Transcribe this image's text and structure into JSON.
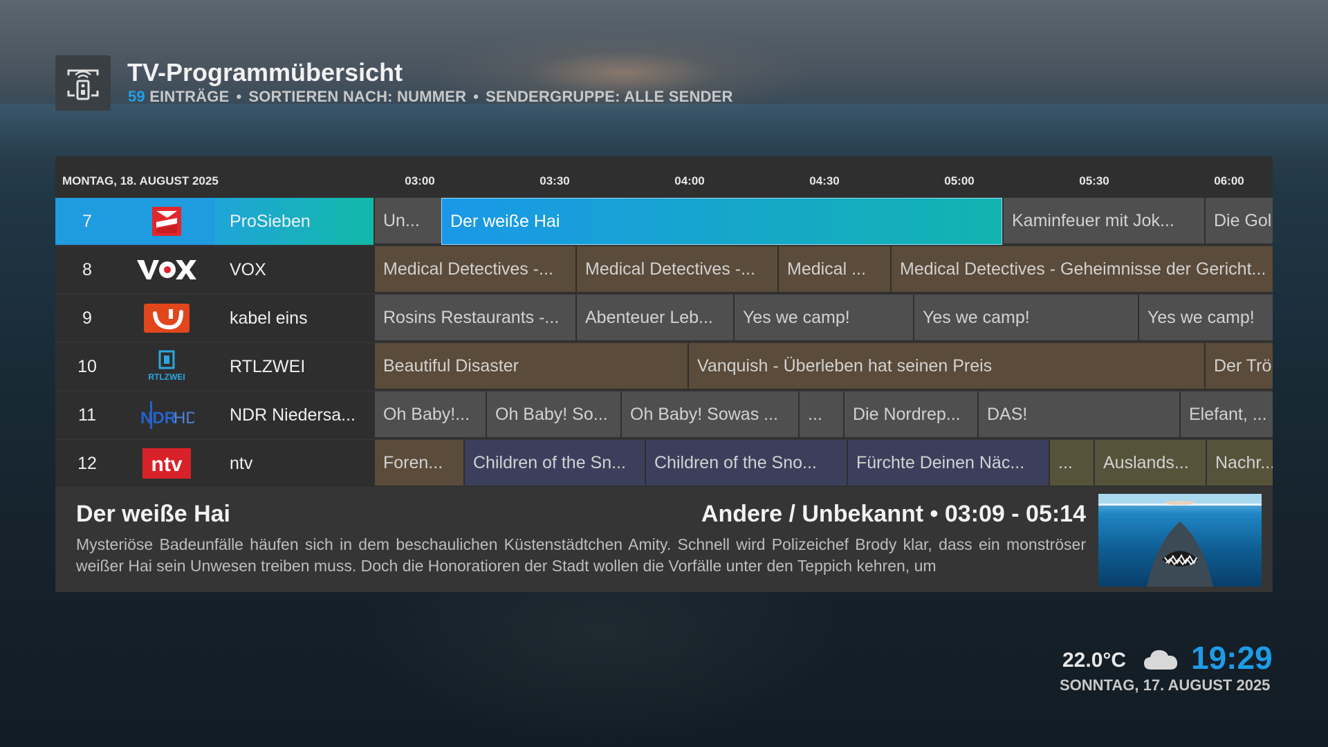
{
  "header": {
    "title": "TV-Programmübersicht",
    "entries_count": "59",
    "entries_label": "EINTRÄGE",
    "sort_label": "SORTIEREN NACH: NUMMER",
    "group_label": "SENDERGRUPPE: ALLE SENDER",
    "icon": "tv-remote-icon"
  },
  "timeline": {
    "date": "MONTAG, 18. AUGUST 2025",
    "ticks": [
      "03:00",
      "03:30",
      "04:00",
      "04:30",
      "05:00",
      "05:30",
      "06:00"
    ]
  },
  "channels": [
    {
      "number": "7",
      "name": "ProSieben",
      "logo": "prosieben-logo"
    },
    {
      "number": "8",
      "name": "VOX",
      "logo": "vox-logo"
    },
    {
      "number": "9",
      "name": "kabel eins",
      "logo": "kabel-eins-logo"
    },
    {
      "number": "10",
      "name": "RTLZWEI",
      "logo": "rtlzwei-logo"
    },
    {
      "number": "11",
      "name": "NDR Niedersa...",
      "logo": "ndr-hd-logo"
    },
    {
      "number": "12",
      "name": "ntv",
      "logo": "ntv-logo"
    }
  ],
  "programs": {
    "r0": [
      "Un...",
      "Der weiße Hai",
      "Kaminfeuer mit Jok...",
      "Die Gol"
    ],
    "r1": [
      "Medical Detectives -...",
      "Medical Detectives -...",
      "Medical ...",
      "Medical Detectives - Geheimnisse der Gericht..."
    ],
    "r2": [
      "Rosins Restaurants -...",
      "Abenteuer Leb...",
      "Yes we camp!",
      "Yes we camp!",
      "Yes we camp!"
    ],
    "r3": [
      "Beautiful Disaster",
      "Vanquish - Überleben hat seinen Preis",
      "Der Trö"
    ],
    "r4": [
      "Oh Baby!...",
      "Oh Baby! So...",
      "Oh Baby! Sowas ...",
      "...",
      "Die Nordrep...",
      "DAS!",
      "Elefant, ..."
    ],
    "r5": [
      "Foren...",
      "Children of the Sn...",
      "Children of the Sno...",
      "Fürchte Deinen Näc...",
      "...",
      "Auslands...",
      "Nachr..."
    ]
  },
  "selected": {
    "title": "Der weiße Hai",
    "genre": "Andere / Unbekannt",
    "time": "03:09 - 05:14",
    "description": "Mysteriöse Badeunfälle häufen sich in dem beschaulichen Küstenstädtchen Amity. Schnell wird Polizeichef Brody klar, dass ein monströser weißer Hai sein Unwesen treiben muss. Doch die Honoratioren der Stadt wollen die Vorfälle unter den Teppich kehren, um"
  },
  "status": {
    "temperature": "22.0°C",
    "weather_icon": "cloud-icon",
    "clock": "19:29",
    "today": "SONNTAG, 17. AUGUST 2025"
  },
  "colors": {
    "accent": "#1f9be6",
    "selected_start": "#1a98e8",
    "selected_end": "#12b4b0",
    "ntv_red": "#d8222a",
    "prosieben_red": "#e22a2a",
    "kabel_eins_orange": "#e04a1e"
  }
}
